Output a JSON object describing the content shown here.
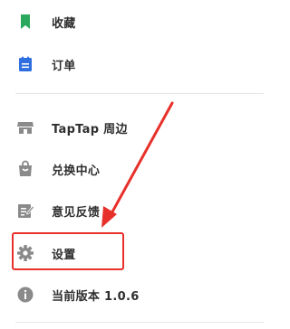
{
  "menu": {
    "items": [
      {
        "label": "收藏",
        "icon": "bookmark-icon",
        "color": "#2aa85c"
      },
      {
        "label": "订单",
        "icon": "order-clipboard-icon",
        "color": "#2f6fe0"
      },
      {
        "label": "TapTap 周边",
        "icon": "store-icon",
        "color": "#8a8a8a"
      },
      {
        "label": "兑换中心",
        "icon": "shopping-bag-icon",
        "color": "#8a8a8a"
      },
      {
        "label": "意见反馈",
        "icon": "feedback-edit-icon",
        "color": "#8a8a8a"
      },
      {
        "label": "设置",
        "icon": "gear-icon",
        "color": "#8a8a8a"
      },
      {
        "label": "当前版本 1.0.6",
        "icon": "info-icon",
        "color": "#8a8a8a"
      }
    ]
  },
  "annotation": {
    "color": "#e8302a",
    "target": "设置"
  }
}
